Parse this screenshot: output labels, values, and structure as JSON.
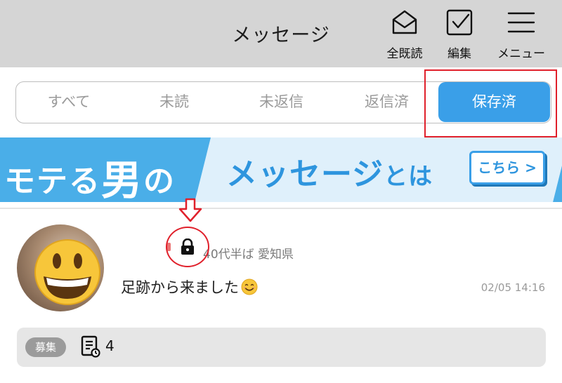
{
  "header": {
    "title": "メッセージ",
    "buttons": [
      {
        "label": "全既読",
        "icon": "envelope-open-icon"
      },
      {
        "label": "編集",
        "icon": "checkbox-edit-icon"
      },
      {
        "label": "メニュー",
        "icon": "hamburger-menu-icon"
      }
    ]
  },
  "tabs": [
    {
      "label": "すべて"
    },
    {
      "label": "未読"
    },
    {
      "label": "未返信"
    },
    {
      "label": "返信済"
    },
    {
      "label": "保存済"
    }
  ],
  "active_tab": "保存済",
  "banner": {
    "left_text_a": "モテる",
    "left_text_b": "男",
    "left_text_c": "の",
    "mid_text_a": "メッセージ",
    "mid_text_b": "とは",
    "cta_label": "こちら >"
  },
  "message": {
    "profile": "40代半ば 愛知県",
    "preview": "足跡から来ました",
    "time": "02/05 14:16",
    "tag": "募集",
    "count": "4"
  },
  "colors": {
    "accent": "#3a9fe8",
    "annotation": "#e0202b",
    "header_bg": "#d5d5d5"
  }
}
